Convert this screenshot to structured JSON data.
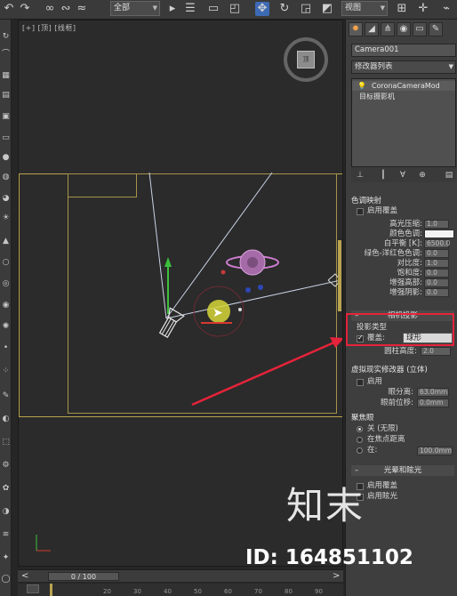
{
  "toolbar": {
    "selection_filter": "全部",
    "reference_coord": "视图"
  },
  "viewport": {
    "label": "[+] [顶] [线框]",
    "viewcube_face": "顶"
  },
  "timeline": {
    "frame_label": "0 / 100",
    "ticks": [
      "20",
      "30",
      "40",
      "50",
      "60",
      "70",
      "80",
      "90"
    ]
  },
  "panel": {
    "object_name": "Camera001",
    "modifier_list": "修改器列表",
    "stack": {
      "item1": "CoronaCameraMod",
      "item2": "目标摄影机"
    },
    "tone": {
      "title": "色调映射",
      "enable_label": "启用覆盖",
      "rows": [
        {
          "label": "高光压缩:",
          "value": "1.0"
        },
        {
          "label": "颜色色调:",
          "value": ""
        },
        {
          "label": "白平衡 [K]:",
          "value": "6500.0"
        },
        {
          "label": "绿色-洋红色色调:",
          "value": "0.0"
        },
        {
          "label": "对比度:",
          "value": "1.0"
        },
        {
          "label": "饱和度:",
          "value": "0.0"
        },
        {
          "label": "增强高部:",
          "value": "0.0"
        },
        {
          "label": "增强阴影:",
          "value": "0.0"
        }
      ]
    },
    "projection": {
      "head": "相机投影",
      "type_label": "投影类型",
      "override_label": "覆盖:",
      "type_value": "球形",
      "height_label": "圆柱高度:",
      "height_value": "2.0"
    },
    "vr": {
      "title": "虚拟现实修改器 (立体)",
      "enable_label": "启用",
      "eye_sep_label": "眼分离:",
      "eye_sep_value": "63.0mm",
      "conv_label": "眼前位移:",
      "conv_value": "0.0mm"
    },
    "focus": {
      "title": "聚焦眼",
      "opt1": "关 (无限)",
      "opt2": "在焦点距离",
      "opt3": "在:",
      "opt3_value": "100.0mm"
    },
    "bloom": {
      "head": "光晕和眩光",
      "enable_label": "启用覆盖",
      "second_label": "启用眩光"
    }
  },
  "watermark": {
    "brand": "知末",
    "id_text": "ID: 164851102"
  },
  "colors": {
    "safe_frame": "#b9a34f",
    "annotation_red": "#e5233a",
    "selected_blue": "#3d6ab5"
  }
}
